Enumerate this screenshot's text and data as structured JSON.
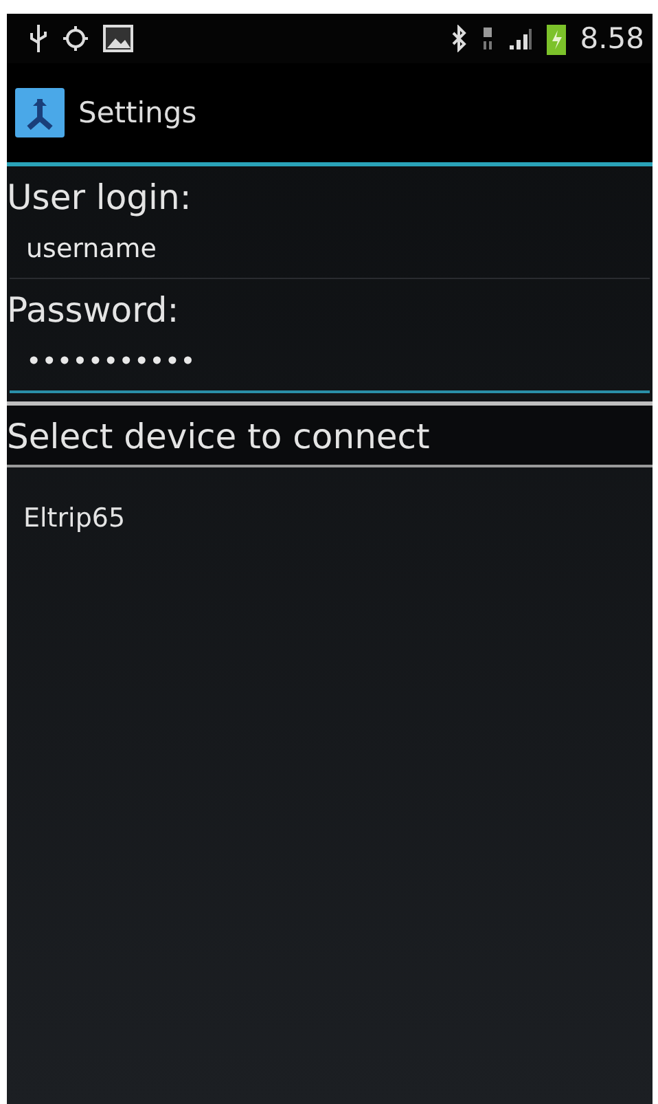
{
  "status_bar": {
    "time": "8.58"
  },
  "action_bar": {
    "title": "Settings"
  },
  "fields": [
    {
      "label": "User login:",
      "value": "username",
      "focused": false
    },
    {
      "label": "Password:",
      "value": "•••••••••••",
      "focused": true
    }
  ],
  "device_list": {
    "header": "Select device to connect",
    "items": [
      {
        "name": "Eltrip65"
      }
    ]
  }
}
